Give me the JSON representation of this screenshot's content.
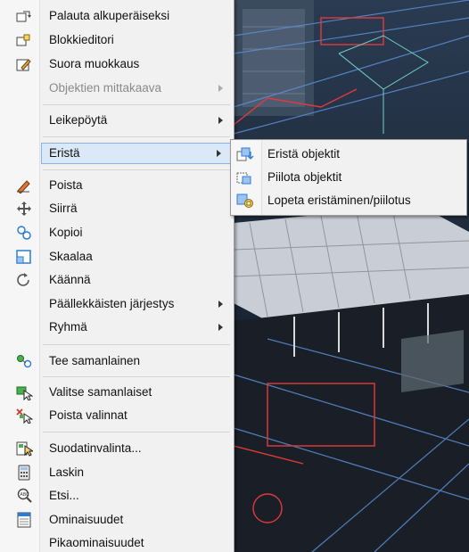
{
  "context_menu": {
    "items": [
      {
        "label": "Palauta alkuperäiseksi",
        "icon": "restore-block-icon"
      },
      {
        "label": "Blokkieditori",
        "icon": "block-editor-icon"
      },
      {
        "label": "Suora muokkaus",
        "icon": "inplace-edit-icon"
      },
      {
        "label": "Objektien mittakaava",
        "disabled": true,
        "submenu": true
      },
      {
        "label": "Leikepöytä",
        "submenu": true
      },
      {
        "label": "Eristä",
        "submenu": true,
        "highlighted": true
      },
      {
        "label": "Poista",
        "icon": "erase-icon"
      },
      {
        "label": "Siirrä",
        "icon": "move-icon"
      },
      {
        "label": "Kopioi",
        "icon": "copy-icon"
      },
      {
        "label": "Skaalaa",
        "icon": "scale-icon"
      },
      {
        "label": "Käännä",
        "icon": "rotate-icon"
      },
      {
        "label": "Päällekkäisten järjestys",
        "submenu": true
      },
      {
        "label": "Ryhmä",
        "submenu": true
      },
      {
        "label": "Tee samanlainen",
        "icon": "add-selected-icon"
      },
      {
        "label": "Valitse samanlaiset",
        "icon": "select-similar-icon"
      },
      {
        "label": "Poista valinnat",
        "icon": "deselect-all-icon"
      },
      {
        "label": "Suodatinvalinta...",
        "icon": "filter-select-icon"
      },
      {
        "label": "Laskin",
        "icon": "calculator-icon"
      },
      {
        "label": "Etsi...",
        "icon": "find-icon"
      },
      {
        "label": "Ominaisuudet",
        "icon": "properties-icon"
      },
      {
        "label": "Pikaominaisuudet"
      }
    ]
  },
  "submenu": {
    "items": [
      {
        "label": "Eristä objektit",
        "icon": "isolate-objects-icon"
      },
      {
        "label": "Piilota objektit",
        "icon": "hide-objects-icon"
      },
      {
        "label": "Lopeta eristäminen/piilotus",
        "icon": "end-isolation-icon"
      }
    ]
  },
  "colors": {
    "highlight": "#dbe8f7",
    "highlight_border": "#8db2e3",
    "menu_bg": "#f1f1f1"
  }
}
